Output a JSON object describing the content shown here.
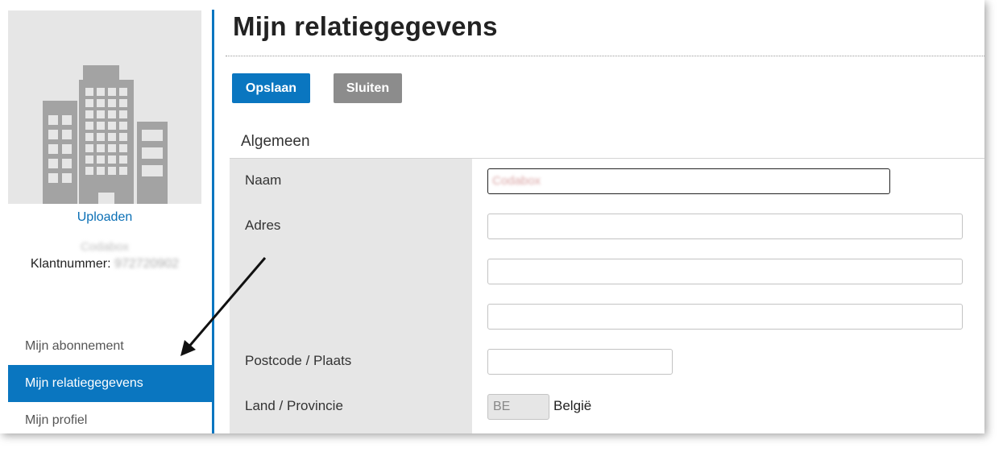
{
  "page": {
    "title": "Mijn relatiegegevens"
  },
  "toolbar": {
    "save_label": "Opslaan",
    "close_label": "Sluiten"
  },
  "sidebar": {
    "upload_label": "Uploaden",
    "company_name": "Codabox",
    "customer_label": "Klantnummer:",
    "customer_number": "972720902",
    "nav": [
      {
        "label": "Mijn abonnement",
        "active": false
      },
      {
        "label": "Mijn relatiegegevens",
        "active": true
      },
      {
        "label": "Mijn profiel",
        "active": false
      }
    ]
  },
  "form": {
    "section_title": "Algemeen",
    "labels": {
      "name": "Naam",
      "address": "Adres",
      "postcode_city": "Postcode / Plaats",
      "country_province": "Land / Provincie"
    },
    "values": {
      "name": "Codabox",
      "address_1": "",
      "address_2": "",
      "address_3": "",
      "postcode": "",
      "country_code": "BE",
      "country_name": "België"
    }
  },
  "colors": {
    "accent": "#0a76c0",
    "button_secondary": "#8c8c8c",
    "label_column": "#e6e6e6"
  }
}
